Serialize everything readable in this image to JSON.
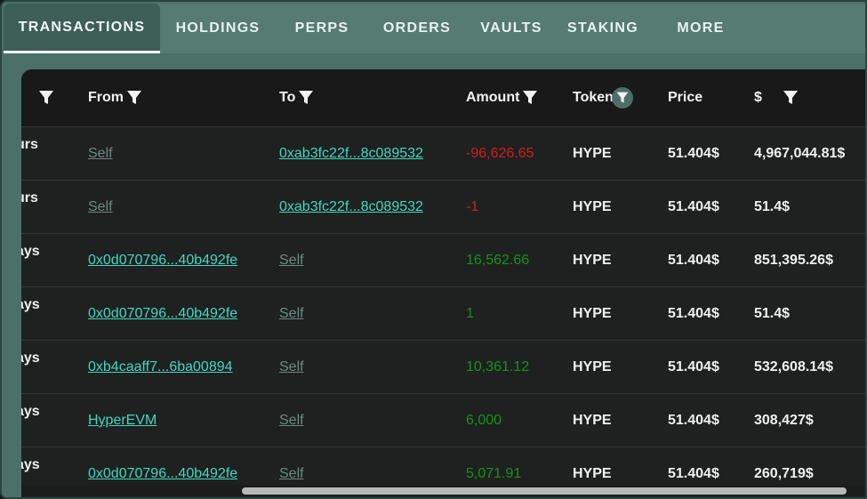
{
  "tabs": [
    {
      "label": "TRANSACTIONS",
      "active": true
    },
    {
      "label": "HOLDINGS"
    },
    {
      "label": "PERPS"
    },
    {
      "label": "ORDERS"
    },
    {
      "label": "VAULTS"
    },
    {
      "label": "STAKING"
    },
    {
      "label": "MORE"
    }
  ],
  "table": {
    "headers": {
      "from": "From",
      "to": "To",
      "amount": "Amount",
      "token": "Token",
      "price": "Price",
      "usd": "$"
    },
    "rows": [
      {
        "time": "urs",
        "from": "Self",
        "to": "0xab3fc22f...8c089532",
        "amount": "-96,626.65",
        "token": "HYPE",
        "price": "51.404$",
        "usd": "4,967,044.81$"
      },
      {
        "time": "urs",
        "from": "Self",
        "to": "0xab3fc22f...8c089532",
        "amount": "-1",
        "token": "HYPE",
        "price": "51.404$",
        "usd": "51.4$"
      },
      {
        "time": "ays",
        "from": "0x0d070796...40b492fe",
        "to": "Self",
        "amount": "16,562.66",
        "token": "HYPE",
        "price": "51.404$",
        "usd": "851,395.26$"
      },
      {
        "time": "ays",
        "from": "0x0d070796...40b492fe",
        "to": "Self",
        "amount": "1",
        "token": "HYPE",
        "price": "51.404$",
        "usd": "51.4$"
      },
      {
        "time": "ays",
        "from": "0xb4caaff7...6ba00894",
        "to": "Self",
        "amount": "10,361.12",
        "token": "HYPE",
        "price": "51.404$",
        "usd": "532,608.14$"
      },
      {
        "time": "ays",
        "from": "HyperEVM",
        "to": "Self",
        "amount": "6,000",
        "token": "HYPE",
        "price": "51.404$",
        "usd": "308,427$"
      },
      {
        "time": "ays",
        "from": "0x0d070796...40b492fe",
        "to": "Self",
        "amount": "5,071.91",
        "token": "HYPE",
        "price": "51.404$",
        "usd": "260,719$"
      }
    ]
  },
  "icons": {
    "filter": "filter-icon",
    "scroll_left": "arrow-left-icon",
    "scroll_right": "arrow-right-icon"
  },
  "colors": {
    "accent_teal": "#44d6c0",
    "negative": "#d11f1f",
    "positive": "#149414",
    "tab_bar": "#557b73"
  }
}
